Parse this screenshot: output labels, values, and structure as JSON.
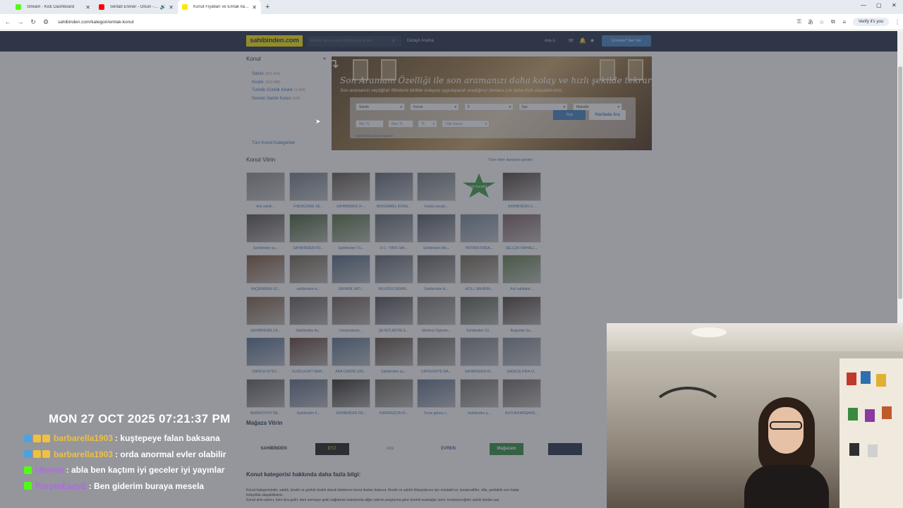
{
  "browser": {
    "tabs": [
      {
        "label": "Stream - Kick Dashboard",
        "fav_color": "#53fc18",
        "active": false
      },
      {
        "label": "Sertab Erener - Olsun - You",
        "fav_color": "#ff0000",
        "active": false
      },
      {
        "label": "Konut Fiyatları ve Emlak İlanla",
        "fav_color": "#ffe800",
        "active": true
      }
    ],
    "url": "sahibinden.com/kategori/emlak-konut",
    "verify_label": "Verify it's you"
  },
  "site": {
    "logo": "sahibinden.com",
    "search_placeholder": "Kelime, ilan no veya mağaza adı ile ara",
    "detailed_search": "Detaylı Arama",
    "user_label": "Ada E.",
    "post_ad_button": "Ücretsiz* İlan Ver",
    "brand_color": "#ffe800",
    "header_color": "#1d2b43"
  },
  "categories": {
    "title": "Konut",
    "items": [
      {
        "label": "Satılık",
        "count": "(421.414)"
      },
      {
        "label": "Kiralık",
        "count": "(202.488)"
      },
      {
        "label": "Turistik Günlük Kiralık",
        "count": "(1.944)"
      },
      {
        "label": "Devren Satılık Konut",
        "count": "(164)"
      }
    ],
    "all_link": "Tüm Konut Kategorileri"
  },
  "banner": {
    "title": "Son Aramam Özelliği ile son aramanızı daha kolay ve hızlı şekilde tekrar uygulayın.",
    "subtitle": "Son aramanızı seçtiğiniz filtrelerle birlikte kolayca uygulayarak aradığınız ilanlara çok daha hızlı ulaşabilirsiniz.",
    "filters_row1": [
      "Satılık",
      "Konut",
      "İl",
      "İlçe",
      "Mahalle"
    ],
    "filters_row2": [
      "Min TL",
      "Max TL",
      "TL",
      "Oda Sayısı"
    ],
    "search_button": "Ara",
    "map_button": "Haritada Ara",
    "more_link": "Daha fazla seçenek göster"
  },
  "showcase": {
    "title": "Konut Vitrin",
    "all_link": "Tüm vitrin ilanlarını göster",
    "items": [
      {
        "cap": "Acil satılık...",
        "c": "#8b8b8b"
      },
      {
        "cap": "FINDIKZADE SE...",
        "c": "#6f7a86"
      },
      {
        "cap": "SAHİBİNDEN 3+...",
        "c": "#5d5248"
      },
      {
        "cap": "MÜKEMMEL KONU...",
        "c": "#5b6472"
      },
      {
        "cap": "Kartal cenapi...",
        "c": "#707a80"
      },
      {
        "cap": "",
        "c": "#3a8a3e"
      },
      {
        "cap": "SAHİBİNDEN 3...",
        "c": "#4b3c34"
      },
      {
        "cap": "Sahibinden sa...",
        "c": "#524a44"
      },
      {
        "cap": "SAHİBİNDEN FO...",
        "c": "#3f5a2e"
      },
      {
        "cap": "Sahibinden Tü...",
        "c": "#4f6b3d"
      },
      {
        "cap": "2+1 - YAPU MA...",
        "c": "#5e6670"
      },
      {
        "cap": "Sahibinden Ma...",
        "c": "#4e5561"
      },
      {
        "cap": "YATIRIM FIRSA...",
        "c": "#6f8397"
      },
      {
        "cap": "SELÇUK MAHALL...",
        "c": "#7a5a60"
      },
      {
        "cap": "KAÇIRMSAN ÜZ...",
        "c": "#7a5238"
      },
      {
        "cap": "sahibinden si...",
        "c": "#70604f"
      },
      {
        "cap": "SAHİBİN SATI...",
        "c": "#4e627a"
      },
      {
        "cap": "NİLÜFER DEMİR...",
        "c": "#5c6570"
      },
      {
        "cap": "Sahibinden ki...",
        "c": "#5d5a58"
      },
      {
        "cap": "ACİLL SAHİBİN...",
        "c": "#6f6450"
      },
      {
        "cap": "Acil sahibind...",
        "c": "#5e7a4a"
      },
      {
        "cap": "SAHİBİNDEN CA...",
        "c": "#7b5a42"
      },
      {
        "cap": "Sahibinden Av...",
        "c": "#5f5953"
      },
      {
        "cap": "Üniversitenin...",
        "c": "#6a5750"
      },
      {
        "cap": "ŞEYETLER'DE E...",
        "c": "#4c4a4e"
      },
      {
        "cap": "Merkezi Ögrenin...",
        "c": "#77736e"
      },
      {
        "cap": "Sahibinden 10...",
        "c": "#525a4a"
      },
      {
        "cap": "Beşiyetle Sa...",
        "c": "#4a3d33"
      },
      {
        "cap": "DARICA GİTEY...",
        "c": "#4e6a8a"
      },
      {
        "cap": "GÜZELKURT MAH...",
        "c": "#5a3d33"
      },
      {
        "cap": "ANA CADDE ÜZE...",
        "c": "#58708a"
      },
      {
        "cap": "Sahibinden ay...",
        "c": "#5a4a3d"
      },
      {
        "cap": "ÜNİVERSİTE MA...",
        "c": "#6a665f"
      },
      {
        "cap": "SAHİBİNDEN Kİ...",
        "c": "#777d84"
      },
      {
        "cap": "SADECE KIKA Ö...",
        "c": "#7c8590"
      },
      {
        "cap": "BERNUTKÖY BE...",
        "c": "#5c5a58"
      },
      {
        "cap": "Sahibinden ti...",
        "c": "#5a6a80"
      },
      {
        "cap": "SAHİBİNDEN DE...",
        "c": "#2e2a22"
      },
      {
        "cap": "KARATAŞ'DA Kİ...",
        "c": "#6a655c"
      },
      {
        "cap": "Turan güneş c...",
        "c": "#5d6f86"
      },
      {
        "cap": "Sahibinden ş...",
        "c": "#73706a"
      },
      {
        "cap": "BÜYÜKKARIŞAHE...",
        "c": "#6e6560"
      }
    ],
    "promo_text": "İlanım burada yer alsın"
  },
  "stores": {
    "title": "Mağaza Vitrin",
    "items": [
      {
        "label": "SAHİBİNDEN",
        "bg": "transparent",
        "fg": "#333"
      },
      {
        "label": "EYZ",
        "bg": "#1a1a1a",
        "fg": "#c9a43a"
      },
      {
        "label": "≡≡≡",
        "bg": "transparent",
        "fg": "#4a6ca0"
      },
      {
        "label": "EVREN",
        "bg": "#fff",
        "fg": "#7a3ca0"
      },
      {
        "label": "Mağazam",
        "bg": "#2e8b3e",
        "fg": "#fff"
      },
      {
        "label": "",
        "bg": "#1d2b43",
        "fg": "#fff"
      }
    ]
  },
  "info": {
    "title": "Konut kategorisi hakkında daha fazla bilgi:",
    "lines": [
      "Konut kategorisinde; satılık, kiralık ve günlük kiralık olarak listelenen konut ilanları bulunur. Kiralık ve satılık ihtiyaçlarınız için müstakil ev, kooperatifler, villa, prefabrik eve kadar",
      "kolaylıkla ulaşabilirsiniz.",
      "Konut alım satımı, hem kira geliri, hem sermaye geliri sağlaması bakımında diğer yatırım araçlarına göre önemli avantajlar içerir. İnceleyeceğiniz satılık ilanları ara"
    ]
  },
  "stream": {
    "clock": "MON 27 OCT 2025 07:21:37 PM",
    "chat": [
      {
        "user": "barbarella1903",
        "msg": ": kuştepeye falan baksana",
        "color": "#f0c040",
        "badges": [
          "#4aa3df",
          "#f0c040",
          "#f0c040"
        ]
      },
      {
        "user": "barbarella1903",
        "msg": ": orda anormal evler olabilir",
        "color": "#f0c040",
        "badges": [
          "#4aa3df",
          "#f0c040",
          "#f0c040"
        ]
      },
      {
        "user": "Utonse",
        "msg": ": abla ben kaçtım iyi geceler iyi yayınlar",
        "color": "#b06ae0",
        "badges": [
          "#53fc18"
        ]
      },
      {
        "user": "PurpleEazyE",
        "msg": ": Ben giderim buraya mesela",
        "color": "#b06ae0",
        "badges": [
          "#53fc18"
        ]
      }
    ]
  }
}
